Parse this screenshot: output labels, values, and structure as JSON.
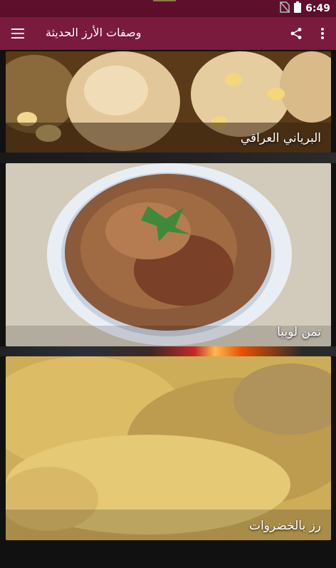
{
  "status_bar": {
    "time": "6:49"
  },
  "app_bar": {
    "title": "وصفات الأرز الحديثة"
  },
  "recipes": [
    {
      "label": "البرياني العراقي"
    },
    {
      "label": "تمن لوبيا"
    },
    {
      "label": "رز بالخضروات"
    }
  ],
  "colors": {
    "status_bar": "#5e0f2c",
    "app_bar": "#7a1a3d"
  }
}
